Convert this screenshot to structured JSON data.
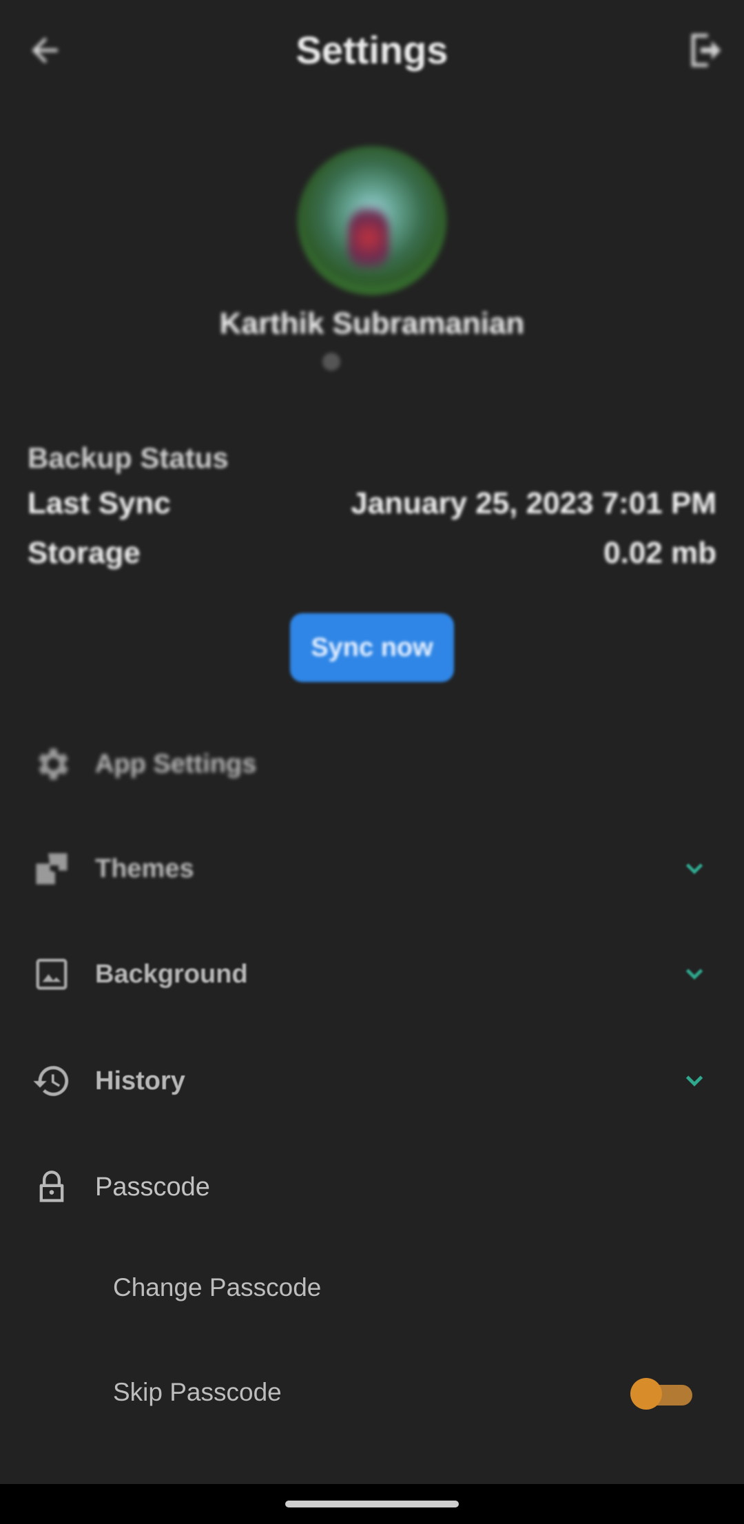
{
  "header": {
    "title": "Settings",
    "back_icon": "arrow-left-icon",
    "logout_icon": "logout-icon"
  },
  "profile": {
    "name": "Karthik Subramanian"
  },
  "backup": {
    "heading": "Backup Status",
    "last_sync_label": "Last Sync",
    "last_sync_value": "January 25, 2023 7:01 PM",
    "storage_label": "Storage",
    "storage_value": "0.02 mb",
    "sync_button": "Sync now"
  },
  "menu": {
    "app_settings": "App Settings",
    "themes": "Themes",
    "background": "Background",
    "history": "History",
    "passcode": "Passcode",
    "change_passcode": "Change Passcode",
    "skip_passcode": "Skip Passcode"
  },
  "colors": {
    "background": "#222222",
    "accent_teal": "#2fa88e",
    "button_blue": "#2f86e6",
    "toggle_orange": "#d88c2a"
  },
  "toggles": {
    "skip_passcode_on": true
  }
}
